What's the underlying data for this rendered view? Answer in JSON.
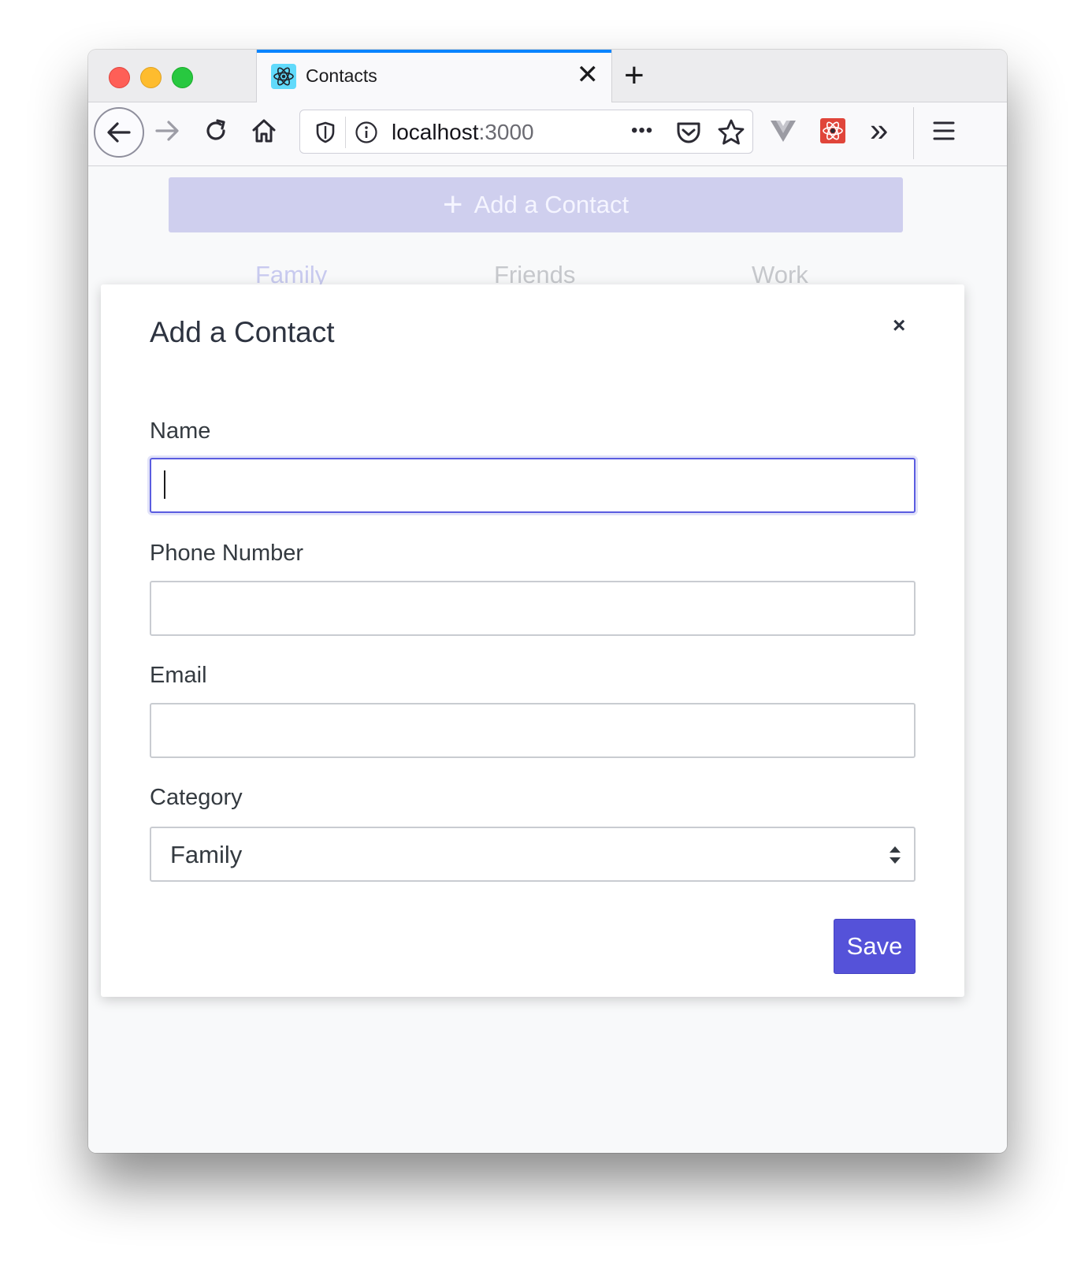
{
  "browser": {
    "tab_title": "Contacts",
    "tab_close": "✕",
    "new_tab": "+",
    "url_host": "localhost",
    "url_port": ":3000",
    "url_more": "•••",
    "overflow": "»",
    "menu": "≡"
  },
  "page": {
    "add_contact_label": "Add a Contact",
    "add_contact_icon": "+",
    "category_tabs": [
      "Family",
      "Friends",
      "Work"
    ]
  },
  "modal": {
    "title": "Add a Contact",
    "close": "×",
    "fields": {
      "name_label": "Name",
      "name_value": "",
      "phone_label": "Phone Number",
      "phone_value": "",
      "email_label": "Email",
      "email_value": "",
      "category_label": "Category",
      "category_value": "Family"
    },
    "save_label": "Save"
  },
  "colors": {
    "accent": "#5552d9",
    "tab_accent": "#0a84ff",
    "add_bar": "#cfcfee"
  },
  "icons": [
    "react-favicon",
    "back-arrow-icon",
    "forward-arrow-icon",
    "reload-icon",
    "home-icon",
    "shield-icon",
    "info-icon",
    "pocket-icon",
    "star-icon",
    "vue-devtools-icon",
    "react-devtools-icon",
    "overflow-icon",
    "menu-icon"
  ]
}
